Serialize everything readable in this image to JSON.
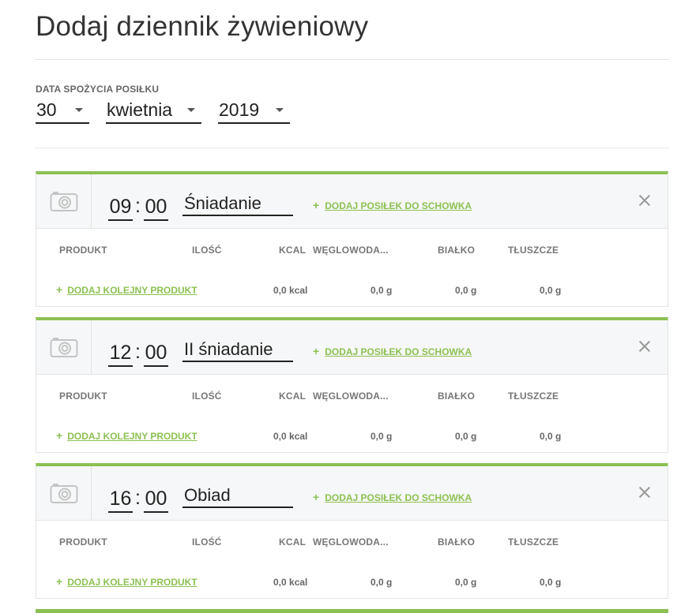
{
  "page": {
    "title": "Dodaj dziennik żywieniowy"
  },
  "date": {
    "label": "DATA SPOŻYCIA POSIŁKU",
    "day": "30",
    "month": "kwietnia",
    "year": "2019"
  },
  "columns": {
    "produkt": "PRODUKT",
    "ilosc": "ILOŚĆ",
    "kcal": "KCAL",
    "wegl": "WĘGLOWODA...",
    "bialko": "BIAŁKO",
    "tluszcze": "TŁUSZCZE"
  },
  "labels": {
    "add_stash": "DODAJ POSIŁEK DO SCHOWKA",
    "add_product": "DODAJ KOLEJNY PRODUKT",
    "plus": "+"
  },
  "meals": [
    {
      "hour": "09",
      "minute": "00",
      "name": "Śniadanie",
      "kcal": "0,0 kcal",
      "wegl": "0,0 g",
      "bialko": "0,0 g",
      "tluszcze": "0,0 g"
    },
    {
      "hour": "12",
      "minute": "00",
      "name": "II śniadanie",
      "kcal": "0,0 kcal",
      "wegl": "0,0 g",
      "bialko": "0,0 g",
      "tluszcze": "0,0 g"
    },
    {
      "hour": "16",
      "minute": "00",
      "name": "Obiad",
      "kcal": "0,0 kcal",
      "wegl": "0,0 g",
      "bialko": "0,0 g",
      "tluszcze": "0,0 g"
    }
  ],
  "colors": {
    "accent": "#8cc152"
  }
}
